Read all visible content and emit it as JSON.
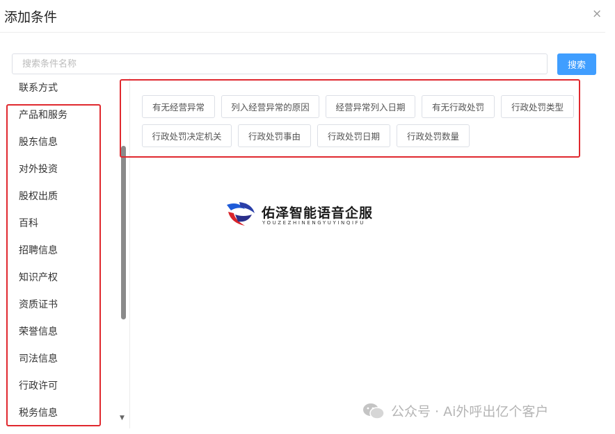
{
  "dialog": {
    "title": "添加条件",
    "close_glyph": "×"
  },
  "search": {
    "placeholder": "搜索条件名称",
    "value": "",
    "button_label": "搜索"
  },
  "sidebar": {
    "items": [
      {
        "label": "联系方式"
      },
      {
        "label": "产品和服务"
      },
      {
        "label": "股东信息"
      },
      {
        "label": "对外投资"
      },
      {
        "label": "股权出质"
      },
      {
        "label": "百科"
      },
      {
        "label": "招聘信息"
      },
      {
        "label": "知识产权"
      },
      {
        "label": "资质证书"
      },
      {
        "label": "荣誉信息"
      },
      {
        "label": "司法信息"
      },
      {
        "label": "行政许可"
      },
      {
        "label": "税务信息"
      }
    ]
  },
  "conditions": {
    "chips": [
      {
        "label": "有无经营异常"
      },
      {
        "label": "列入经营异常的原因"
      },
      {
        "label": "经营异常列入日期"
      },
      {
        "label": "有无行政处罚"
      },
      {
        "label": "行政处罚类型"
      },
      {
        "label": "行政处罚决定机关"
      },
      {
        "label": "行政处罚事由"
      },
      {
        "label": "行政处罚日期"
      },
      {
        "label": "行政处罚数量"
      }
    ]
  },
  "logo": {
    "name": "佑泽智能语音企服",
    "subtitle": "YOUZEZHINENGYUYINQIFU"
  },
  "watermark": {
    "text": "公众号 · Ai外呼出亿个客户"
  },
  "colors": {
    "accent": "#409eff",
    "highlight": "#e0282e",
    "border": "#dcdfe6"
  }
}
